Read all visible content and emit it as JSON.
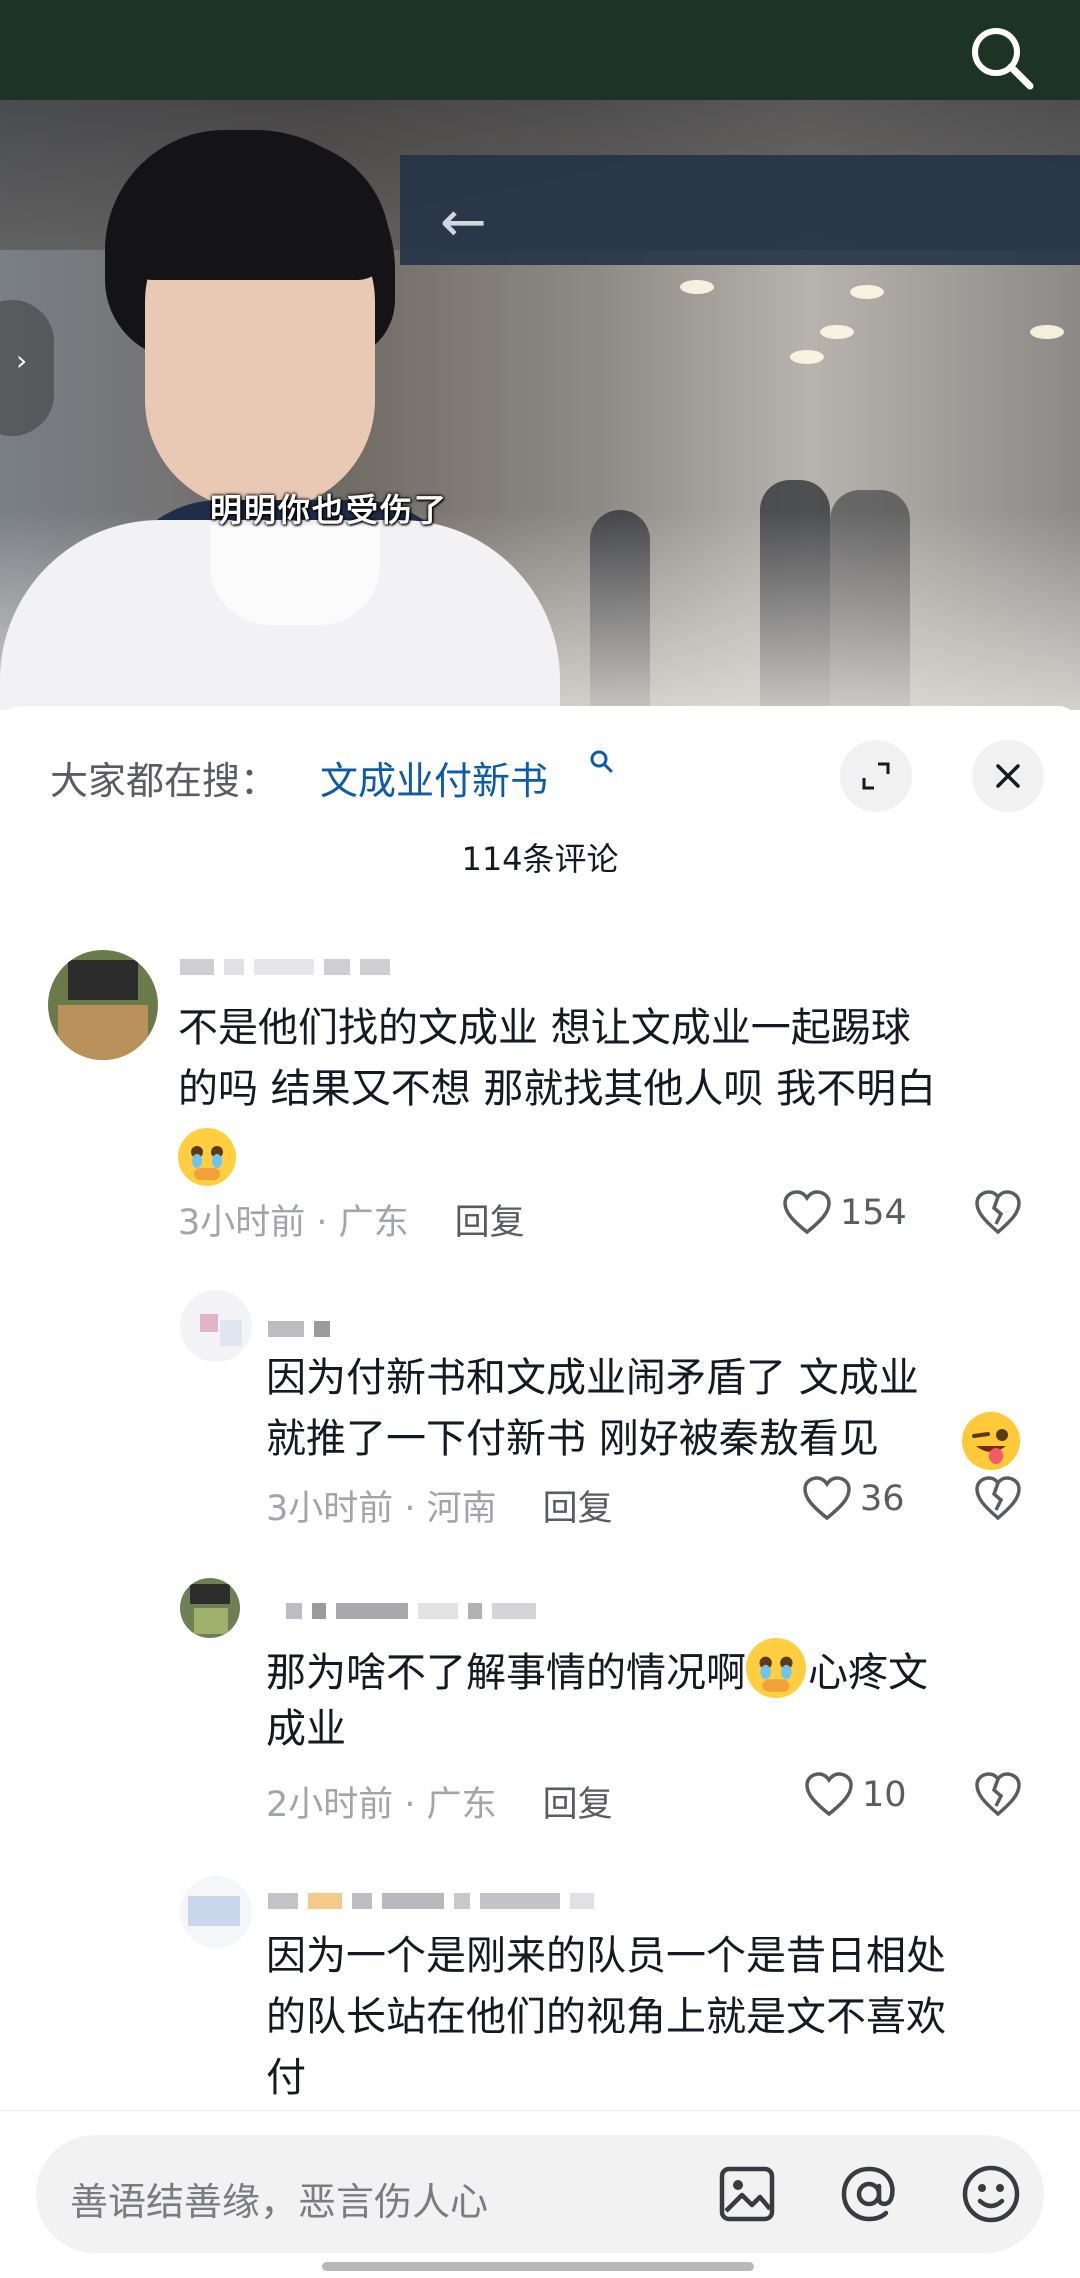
{
  "video": {
    "subtitle": "明明你也受伤了"
  },
  "sheet": {
    "hot_search_label": "大家都在搜：",
    "hot_search_term": "文成业付新书",
    "comment_count": "114条评论"
  },
  "comments": [
    {
      "text_line1": "不是他们找的文成业 想让文成业一起踢球",
      "text_line2": "的吗 结果又不想 那就找其他人呗 我不明白",
      "emoji": "crying-face",
      "time": "3小时前 · 广东",
      "reply": "回复",
      "likes": "154"
    },
    {
      "text_line1": "因为付新书和文成业闹矛盾了  文成业",
      "text_line2": "就推了一下付新书  刚好被秦敖看见",
      "emoji": "winking-tongue-face",
      "time": "3小时前 · 河南",
      "reply": "回复",
      "likes": "36"
    },
    {
      "text_line1": "那为啥不了解事情的情况啊",
      "text_line1b": "心疼文",
      "text_line2": "成业",
      "emoji": "crying-face",
      "time": "2小时前 · 广东",
      "reply": "回复",
      "likes": "10"
    },
    {
      "text_line1": "因为一个是刚来的队员一个是昔日相处",
      "text_line2": "的队长站在他们的视角上就是文不喜欢",
      "text_line3": "付"
    }
  ],
  "input": {
    "placeholder": "善语结善缘，恶言伤人心"
  },
  "colors": {
    "link_blue": "#0d5aa7",
    "top_bar": "#1d3324",
    "meta_gray": "#a3a4a9"
  }
}
